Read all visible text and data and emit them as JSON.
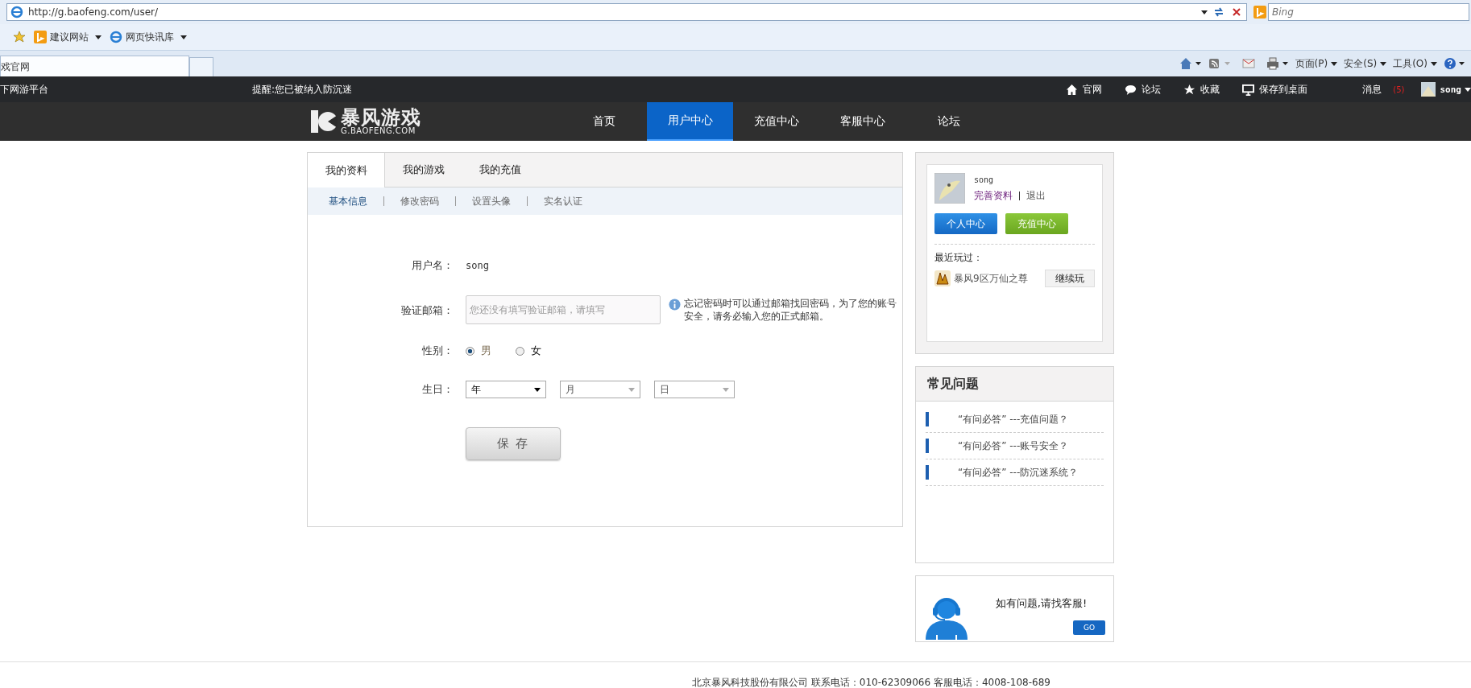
{
  "browser": {
    "address": "http://g.baofeng.com/user/",
    "search_placeholder": "Bing",
    "favorites": [
      {
        "label": "建议网站",
        "kind": "bing"
      },
      {
        "label": "网页快讯库",
        "kind": "ie"
      }
    ],
    "tab_title": "戏官网",
    "commands": [
      {
        "kind": "home"
      },
      {
        "kind": "feed"
      },
      {
        "kind": "mail"
      },
      {
        "kind": "print"
      },
      {
        "kind": "text",
        "label": "页面(P)"
      },
      {
        "kind": "text",
        "label": "安全(S)"
      },
      {
        "kind": "text",
        "label": "工具(O)"
      },
      {
        "kind": "help"
      }
    ]
  },
  "site_bar": {
    "left": "下网游平台",
    "notice": "提醒:您已被纳入防沉迷",
    "links": [
      {
        "label": "官网",
        "kind": "home"
      },
      {
        "label": "论坛",
        "kind": "chat"
      },
      {
        "label": "收藏",
        "kind": "star"
      },
      {
        "label": "保存到桌面",
        "kind": "monitor"
      }
    ],
    "messages": "消息",
    "message_count": "(5)",
    "user": "song"
  },
  "nav": {
    "logo": "暴风游戏",
    "logo_sub": "G.BAOFENG.COM",
    "items": [
      {
        "label": "首页",
        "selected": false
      },
      {
        "label": "用户中心",
        "selected": true
      },
      {
        "label": "充值中心",
        "selected": false
      },
      {
        "label": "客服中心",
        "selected": false
      },
      {
        "label": "论坛",
        "selected": false
      }
    ]
  },
  "profile": {
    "tabs": [
      {
        "label": "我的资料",
        "selected": true
      },
      {
        "label": "我的游戏",
        "selected": false
      },
      {
        "label": "我的充值",
        "selected": false
      }
    ],
    "subtabs": [
      {
        "label": "基本信息",
        "selected": true
      },
      {
        "label": "修改密码",
        "selected": false
      },
      {
        "label": "设置头像",
        "selected": false
      },
      {
        "label": "实名认证",
        "selected": false
      }
    ],
    "username_label": "用户名：",
    "username": "song",
    "email_label": "验证邮箱：",
    "email_placeholder": "您还没有填写验证邮箱，请填写",
    "email_hint": "忘记密码时可以通过邮箱找回密码，为了您的账号安全，请务必输入您的正式邮箱。",
    "gender_label": "性别：",
    "genders": [
      {
        "label": "男",
        "selected": true
      },
      {
        "label": "女",
        "selected": false
      }
    ],
    "birthday_label": "生日：",
    "birthday": [
      {
        "value": "年",
        "disabled": false
      },
      {
        "value": "月",
        "disabled": true
      },
      {
        "value": "日",
        "disabled": true
      }
    ],
    "save": "保 存"
  },
  "account": {
    "user": "song",
    "complete_link": "完善资料",
    "logout": "退出",
    "buttons": [
      {
        "label": "个人中心",
        "kind": "blue"
      },
      {
        "label": "充值中心",
        "kind": "green"
      }
    ],
    "recent_label": "最近玩过：",
    "recent_game": "暴风9区万仙之尊",
    "continue": "继续玩"
  },
  "faq": {
    "title": "常见问题",
    "items": [
      "“有问必答” ---充值问题？",
      "“有问必答” ---账号安全？",
      "“有问必答” ---防沉迷系统？"
    ]
  },
  "service": {
    "text": "如有问题,请找客服!",
    "button": "GO"
  },
  "footer": "北京暴风科技股份有限公司 联系电话：010-62309066 客服电话：4008-108-689"
}
